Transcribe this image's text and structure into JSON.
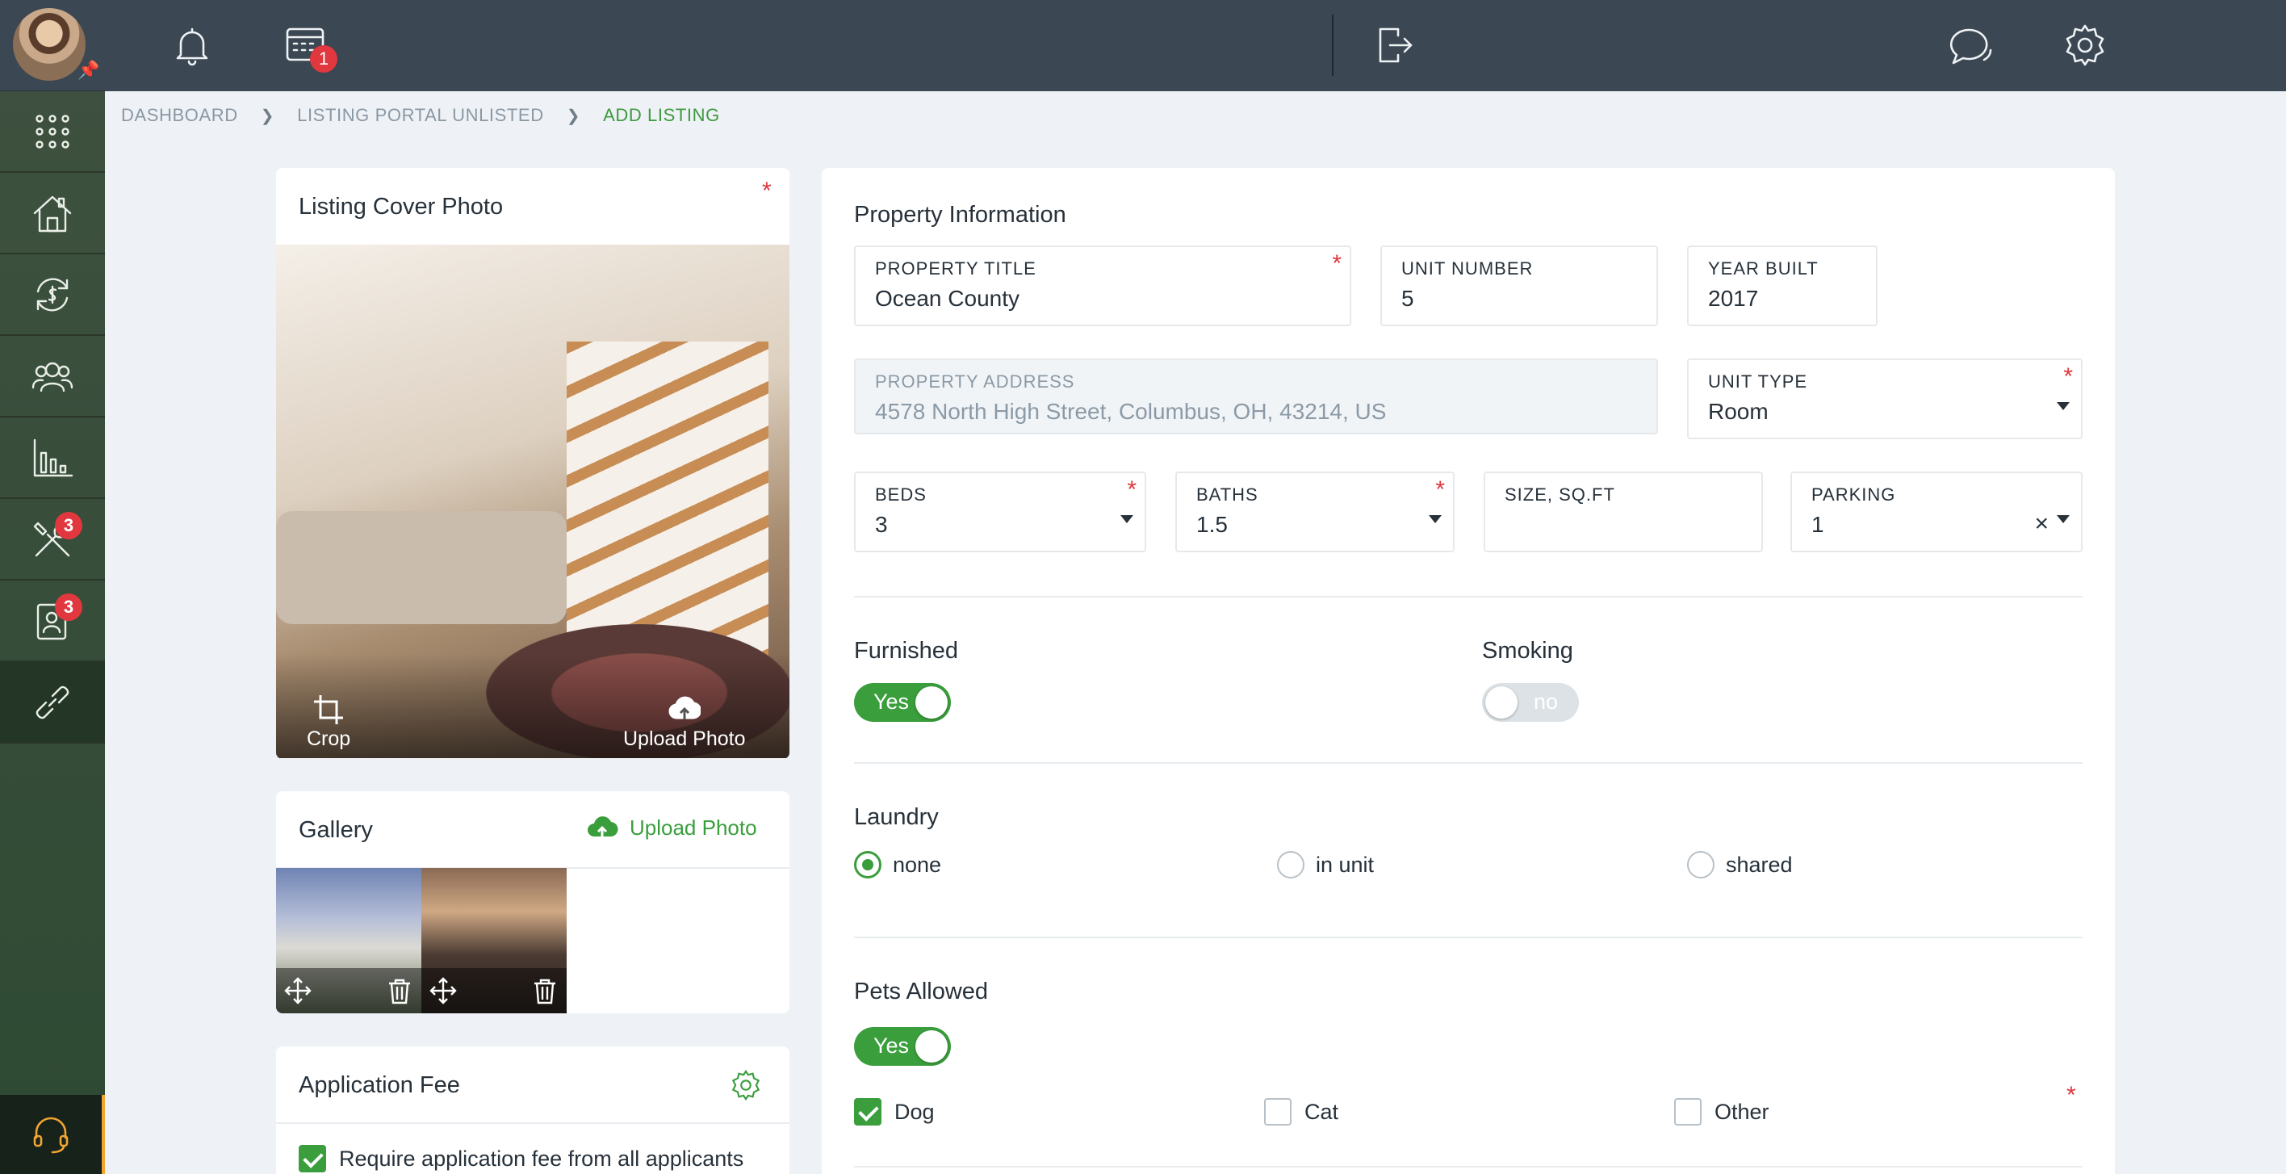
{
  "topbar": {
    "calendar_badge": "1"
  },
  "sidebar": {
    "tools_badge": "3",
    "applicants_badge": "3"
  },
  "breadcrumb": {
    "items": [
      "DASHBOARD",
      "LISTING PORTAL UNLISTED",
      "ADD LISTING"
    ]
  },
  "cover": {
    "title": "Listing Cover Photo",
    "crop_label": "Crop",
    "upload_label": "Upload Photo"
  },
  "gallery": {
    "title": "Gallery",
    "upload_label": "Upload Photo"
  },
  "fee": {
    "title": "Application Fee",
    "require_label": "Require application fee from all applicants"
  },
  "property": {
    "section_title": "Property Information",
    "title_label": "PROPERTY TITLE",
    "title_value": "Ocean County",
    "unit_label": "UNIT NUMBER",
    "unit_value": "5",
    "year_label": "YEAR BUILT",
    "year_value": "2017",
    "address_label": "PROPERTY ADDRESS",
    "address_value": "4578 North High Street, Columbus, OH, 43214, US",
    "unit_type_label": "UNIT TYPE",
    "unit_type_value": "Room",
    "beds_label": "BEDS",
    "beds_value": "3",
    "baths_label": "BATHS",
    "baths_value": "1.5",
    "size_label": "SIZE, SQ.FT",
    "size_value": "",
    "parking_label": "PARKING",
    "parking_value": "1"
  },
  "amenities": {
    "furnished_label": "Furnished",
    "furnished_state": "Yes",
    "smoking_label": "Smoking",
    "smoking_state": "no",
    "laundry_label": "Laundry",
    "laundry_options": [
      "none",
      "in unit",
      "shared"
    ],
    "pets_label": "Pets Allowed",
    "pets_state": "Yes",
    "pet_options": [
      "Dog",
      "Cat",
      "Other"
    ]
  },
  "colors": {
    "accent": "#3a9e3c",
    "topbar": "#3b4752",
    "badge": "#e0383e",
    "required": "#e0383e"
  },
  "icons": [
    "bell-icon",
    "calendar-icon",
    "chat-icon",
    "gear-icon",
    "logout-icon",
    "apps-grid-icon",
    "house-icon",
    "money-cycle-icon",
    "people-icon",
    "chart-icon",
    "tools-icon",
    "applicant-icon",
    "link-icon",
    "headset-icon",
    "crop-icon",
    "upload-cloud-icon",
    "move-icon",
    "trash-icon"
  ]
}
